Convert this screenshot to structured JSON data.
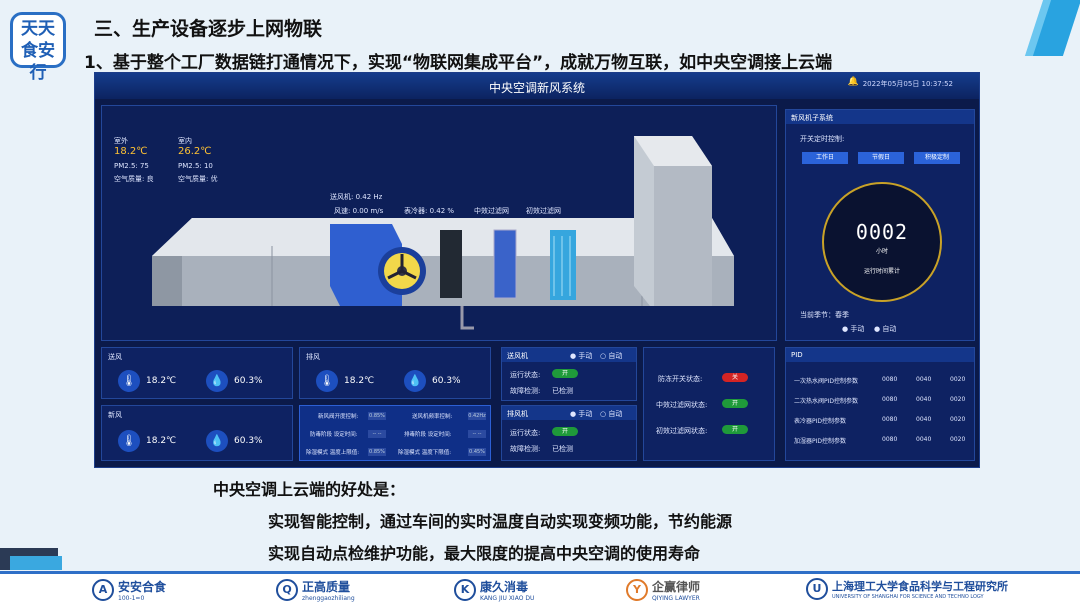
{
  "slide": {
    "logo_text": "天天食安行",
    "title": "三、生产设备逐步上网物联",
    "subtitle": "1、基于整个工厂数据链打通情况下，实现“物联网集成平台”，成就万物互联，如中央空调接上云端",
    "benefit_title": "中央空调上云端的好处是：",
    "benefits": [
      "实现智能控制，通过车间的实时温度自动实现变频功能，节约能源",
      "实现自动点检维护功能，最大限度的提高中央空调的使用寿命"
    ]
  },
  "dashboard": {
    "title": "中央空调新风系统",
    "datetime": "2022年05月05日 10:37:52",
    "outdoor": {
      "label": "室外",
      "temp": "18.2℃",
      "pm": "PM2.5: 75",
      "air": "空气质量: 良"
    },
    "indoor": {
      "label": "室内",
      "temp": "26.2℃",
      "pm": "PM2.5: 10",
      "air": "空气质量: 优"
    },
    "unit_labels": {
      "fan_freq": "送风机: 0.42 Hz",
      "wind_speed": "风速: 0.00 m/s",
      "cooler": "表冷器: 0.42 %",
      "mid_filter": "中效过滤网",
      "primary_filter": "初效过滤网"
    },
    "subsystem": {
      "title": "新风机子系统",
      "switch_label": "开关定时控制:",
      "buttons": [
        "工作日",
        "节假日",
        "积极定制"
      ],
      "counter": "0002",
      "counter_unit": "小时",
      "counter_label": "运行时间累计",
      "season": "当前季节：春季",
      "mode_manual": "手动",
      "mode_auto": "自动"
    },
    "supply": {
      "title": "送风",
      "temp": "18.2℃",
      "humidity": "60.3%"
    },
    "exhaust": {
      "title": "排风",
      "temp": "18.2℃",
      "humidity": "60.3%"
    },
    "fresh": {
      "title": "新风",
      "temp": "18.2℃",
      "humidity": "60.3%"
    },
    "controls": {
      "r1a": "新风阀开度控制:",
      "r1a_val": "0.85%",
      "r1b": "送风机频率控制:",
      "r1b_val": "0.42Hz",
      "r2a": "防毒阶段 设定时间:",
      "r2a_val": "-- --",
      "r2b": "排毒阶段 设定时间:",
      "r2b_val": "-- --",
      "r3a": "除湿模式 温度上限值:",
      "r3a_val": "0.85%",
      "r3b": "除湿模式 温度下限值:",
      "r3b_val": "0.45%"
    },
    "supply_fan": {
      "title": "送风机",
      "manual": "手动",
      "auto": "自动",
      "run_label": "运行状态:",
      "run_val": "开",
      "fault_label": "故障检测:",
      "fault_val": "已检测"
    },
    "exhaust_fan": {
      "title": "排风机",
      "manual": "手动",
      "auto": "自动",
      "run_label": "运行状态:",
      "run_val": "开",
      "fault_label": "故障检测:",
      "fault_val": "已检测"
    },
    "status": {
      "freeze_label": "防冻开关状态:",
      "freeze_val": "关",
      "mid_label": "中效过滤网状态:",
      "mid_val": "开",
      "primary_label": "初效过滤网状态:",
      "primary_val": "开"
    },
    "pid": {
      "title": "PID",
      "rows": [
        {
          "name": "一次热水阀PID控制参数",
          "v": [
            "0080",
            "0040",
            "0020"
          ]
        },
        {
          "name": "二次热水阀PID控制参数",
          "v": [
            "0080",
            "0040",
            "0020"
          ]
        },
        {
          "name": "表冷器PID控制参数",
          "v": [
            "0080",
            "0040",
            "0020"
          ]
        },
        {
          "name": "加湿器PID控制参数",
          "v": [
            "0080",
            "0040",
            "0020"
          ]
        }
      ]
    }
  },
  "footer": {
    "brands": [
      {
        "name": "安安合食",
        "sub": "100-1=0"
      },
      {
        "name": "正高质量",
        "sub": "zhenggaozhiliang"
      },
      {
        "name": "康久消毒",
        "sub": "KANG JIU XIAO DU"
      },
      {
        "name": "企赢律师",
        "sub": "QIYING LAWYER"
      },
      {
        "name": "上海理工大学食品科学与工程研究所",
        "sub": "UNIVERSITY OF SHANGHAI FOR SCIENCE AND TECHNO LOGY"
      }
    ]
  }
}
